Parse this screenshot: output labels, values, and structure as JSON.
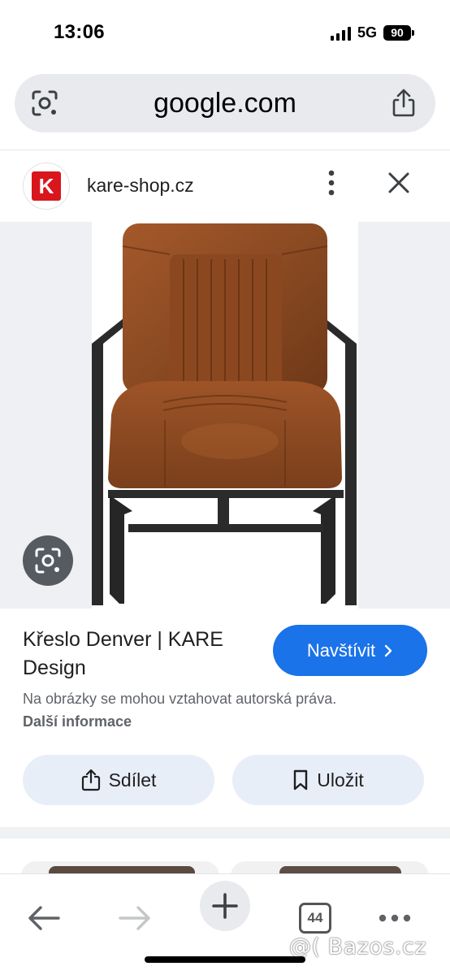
{
  "status_bar": {
    "time": "13:06",
    "network": "5G",
    "battery": "90"
  },
  "url_bar": {
    "domain": "google.com"
  },
  "source": {
    "logo_letter": "K",
    "domain": "kare-shop.cz"
  },
  "result": {
    "title": "Křeslo Denver | KARE Design",
    "visit_label": "Navštívit",
    "disclaimer": "Na obrázky se mohou vztahovat autorská práva.",
    "more_info": "Další informace"
  },
  "actions": {
    "share_label": "Sdílet",
    "save_label": "Uložit"
  },
  "toolbar": {
    "tab_count": "44"
  },
  "watermark": "@( Bazos.cz",
  "colors": {
    "accent": "#1a73e8",
    "logo_red": "#d8161c",
    "leather": "#8a4a22"
  },
  "icons": [
    "lens-icon",
    "share-icon",
    "more-vert-icon",
    "close-icon",
    "chevron-right-icon",
    "bookmark-icon",
    "back-arrow-icon",
    "forward-arrow-icon",
    "plus-icon",
    "tabs-icon",
    "more-horiz-icon"
  ]
}
